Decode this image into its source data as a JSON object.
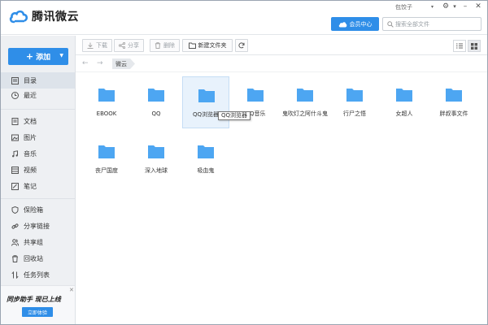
{
  "app": {
    "title": "腾讯微云"
  },
  "titlebar": {
    "user": "包饺子",
    "vip_label": "会员中心",
    "search_placeholder": "搜索全部文件"
  },
  "sidebar": {
    "add_label": "添加",
    "items": [
      {
        "label": "目录",
        "icon": "directory-icon",
        "active": true
      },
      {
        "label": "最近",
        "icon": "clock-icon"
      },
      {
        "label": "文档",
        "icon": "document-icon"
      },
      {
        "label": "图片",
        "icon": "image-icon"
      },
      {
        "label": "音乐",
        "icon": "music-icon"
      },
      {
        "label": "视频",
        "icon": "video-icon"
      },
      {
        "label": "笔记",
        "icon": "note-icon"
      },
      {
        "label": "保险箱",
        "icon": "shield-icon"
      },
      {
        "label": "分享链接",
        "icon": "link-icon"
      },
      {
        "label": "共享组",
        "icon": "group-icon"
      },
      {
        "label": "回收站",
        "icon": "trash-icon"
      },
      {
        "label": "任务列表",
        "icon": "transfer-icon"
      }
    ],
    "promo": {
      "title": "同步助手 现已上线",
      "button": "立即体验"
    }
  },
  "toolbar": {
    "download": "下载",
    "share": "分享",
    "delete": "删除",
    "new_folder": "新建文件夹"
  },
  "breadcrumb": {
    "current": "微云"
  },
  "files": [
    {
      "name": "EBOOK"
    },
    {
      "name": "QQ"
    },
    {
      "name": "QQ浏览器",
      "selected": true
    },
    {
      "name": "QQ音乐"
    },
    {
      "name": "鬼吹灯之阿什斗鬼"
    },
    {
      "name": "行尸之悟"
    },
    {
      "name": "女超人"
    },
    {
      "name": "胖叔事文件"
    },
    {
      "name": "丧尸国度"
    },
    {
      "name": "深入地球"
    },
    {
      "name": "吸血鬼"
    }
  ],
  "tooltip": "QQ浏览器",
  "colors": {
    "accent": "#2f8ee8",
    "folder": "#4da6f2"
  }
}
